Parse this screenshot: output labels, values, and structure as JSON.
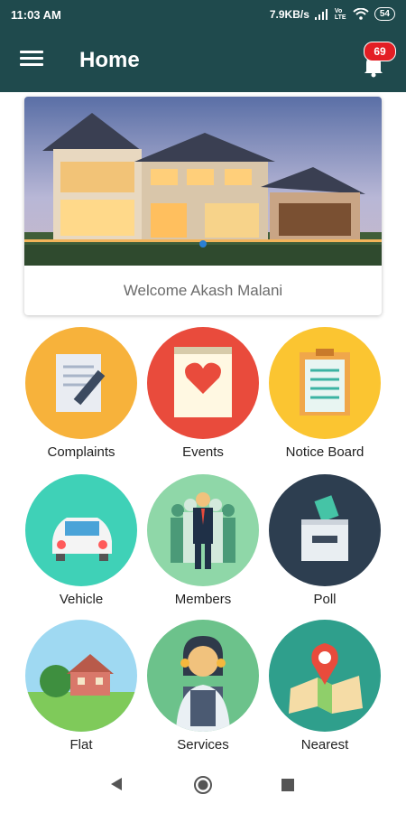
{
  "status_bar": {
    "time": "11:03 AM",
    "speed": "7.9KB/s",
    "network": "Vo LTE",
    "battery": "54"
  },
  "app_bar": {
    "title": "Home",
    "notification_count": "69"
  },
  "welcome": {
    "text": "Welcome Akash Malani"
  },
  "tiles": [
    {
      "label": "Complaints",
      "icon": "complaints-icon",
      "color": "#f7b23b"
    },
    {
      "label": "Events",
      "icon": "events-icon",
      "color": "#e94b3c"
    },
    {
      "label": "Notice Board",
      "icon": "notice-board-icon",
      "color": "#fbc531"
    },
    {
      "label": "Vehicle",
      "icon": "vehicle-icon",
      "color": "#3fd1b7"
    },
    {
      "label": "Members",
      "icon": "members-icon",
      "color": "#8fd7a8"
    },
    {
      "label": "Poll",
      "icon": "poll-icon",
      "color": "#2d3e50"
    },
    {
      "label": "Flat",
      "icon": "flat-icon",
      "color": "#9fd9f2"
    },
    {
      "label": "Services",
      "icon": "services-icon",
      "color": "#6cc28b"
    },
    {
      "label": "Nearest",
      "icon": "nearest-icon",
      "color": "#2f9f8c"
    }
  ],
  "colors": {
    "primary": "#1f4a4d",
    "badge": "#e31e24"
  },
  "nav_bar": {
    "icons": [
      "back-icon",
      "home-icon",
      "recents-icon"
    ]
  }
}
